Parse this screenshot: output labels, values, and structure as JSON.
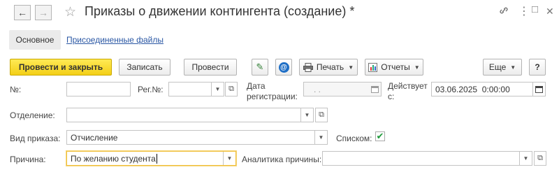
{
  "window": {
    "title": "Приказы о движении контингента (создание) *",
    "back_glyph": "←",
    "forward_glyph": "→",
    "star_glyph": "☆",
    "link_glyph": "🔗",
    "more_glyph": "⋮",
    "maximize_glyph": "□",
    "close_glyph": "✕"
  },
  "tabs": {
    "main": "Основное",
    "attached_files": "Присоединенные файлы"
  },
  "toolbar": {
    "post_and_close": "Провести и закрыть",
    "save": "Записать",
    "post": "Провести",
    "edit_glyph": "✎",
    "at_glyph": "@",
    "print": "Печать",
    "reports": "Отчеты",
    "more": "Еще",
    "help": "?"
  },
  "form": {
    "number_label": "№:",
    "number_value": "",
    "reg_number_label": "Рег.№:",
    "reg_number_value": "",
    "reg_date_label_1": "Дата",
    "reg_date_label_2": "регистрации:",
    "reg_date_value": "  .  .",
    "effective_label_1": "Действует",
    "effective_label_2": "с:",
    "effective_value": "03.06.2025  0:00:00",
    "department_label": "Отделение:",
    "department_value": "",
    "order_type_label": "Вид приказа:",
    "order_type_value": "Отчисление",
    "list_label": "Списком:",
    "list_checked": "✔",
    "reason_label": "Причина:",
    "reason_value": "По желанию студента",
    "reason_analytics_label": "Аналитика причины:",
    "reason_analytics_value": ""
  },
  "colors": {
    "primary_button": "#f5d31f",
    "link": "#2a57a4",
    "checkbox": "#1e9a3a"
  }
}
